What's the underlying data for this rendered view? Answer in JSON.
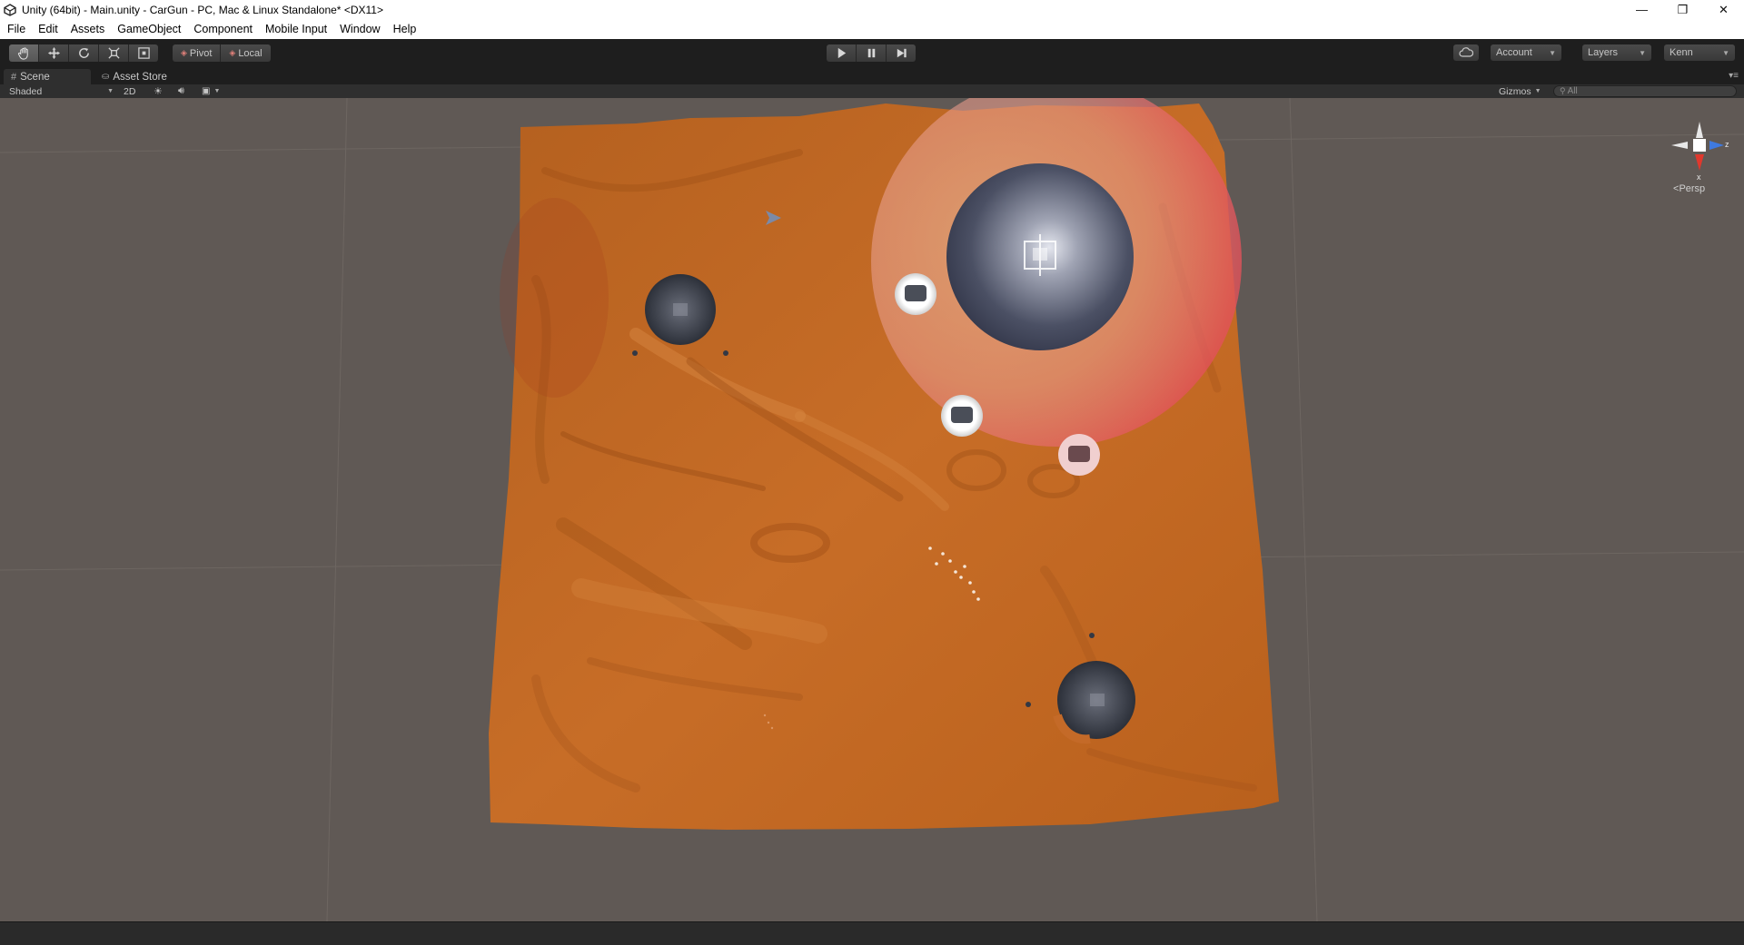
{
  "window": {
    "title": "Unity (64bit) - Main.unity - CarGun - PC, Mac & Linux Standalone* <DX11>",
    "minimize": "—",
    "restore": "❐",
    "close": "✕"
  },
  "menu": [
    "File",
    "Edit",
    "Assets",
    "GameObject",
    "Component",
    "Mobile Input",
    "Window",
    "Help"
  ],
  "toolbar": {
    "transform_tools": [
      "hand-tool-icon",
      "move-tool-icon",
      "rotate-tool-icon",
      "scale-tool-icon",
      "rect-tool-icon"
    ],
    "pivot_label": "Pivot",
    "local_label": "Local",
    "play_controls": [
      "play-icon",
      "pause-icon",
      "step-icon"
    ],
    "account_label": "Account",
    "layers_label": "Layers",
    "layout_label": "Kenn"
  },
  "tabs": {
    "scene_label": "Scene",
    "asset_store_label": "Asset Store"
  },
  "scene_bar": {
    "shading_mode": "Shaded",
    "mode_2d_label": "2D",
    "gizmos_label": "Gizmos",
    "search_placeholder": "All"
  },
  "viewport": {
    "background_color": "#605955",
    "terrain_color": "#c46a28",
    "danger_zone_color": "#e05a5a",
    "projection_label": "Persp",
    "gizmo_z_label": "z"
  }
}
